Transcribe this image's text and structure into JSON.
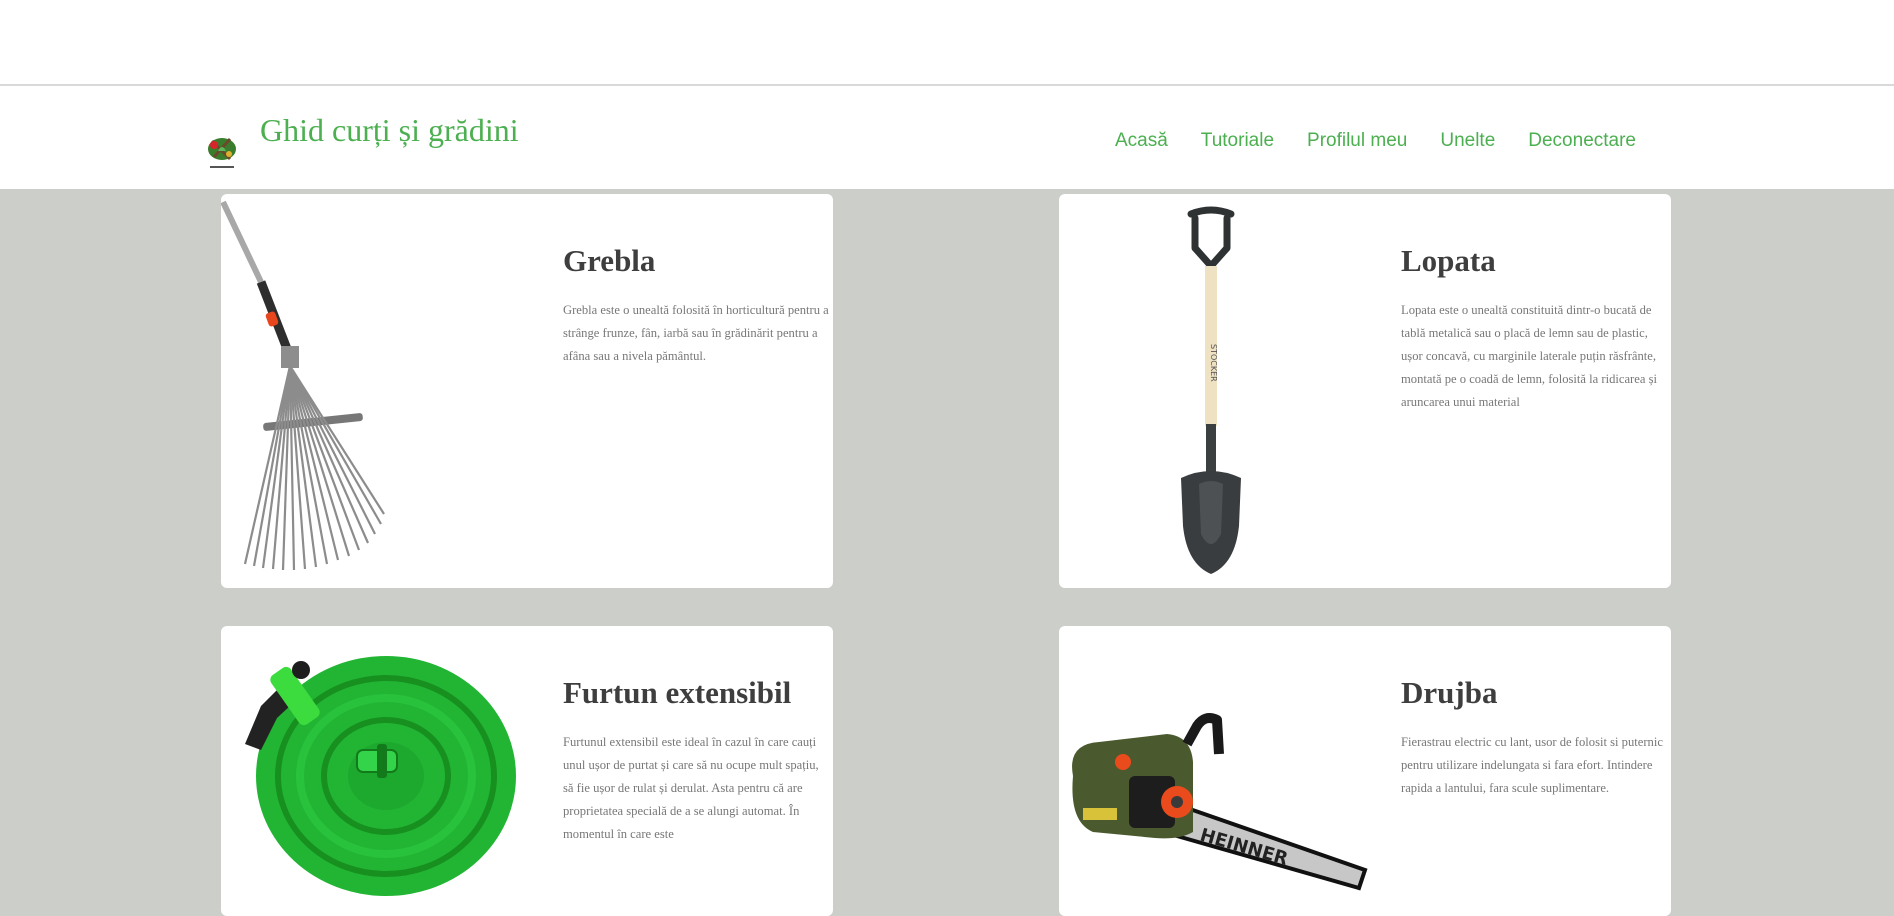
{
  "header": {
    "title": "Ghid curți și grădini",
    "logo_icon": "garden-tools-logo-icon"
  },
  "nav": {
    "items": [
      {
        "label": "Acasă"
      },
      {
        "label": "Tutoriale"
      },
      {
        "label": "Profilul meu"
      },
      {
        "label": "Unelte"
      },
      {
        "label": "Deconectare"
      }
    ]
  },
  "colors": {
    "accent": "#4caf50",
    "page_background": "#ccceca",
    "card_background": "#ffffff",
    "title_text": "#3e3e3e",
    "body_text": "#777777"
  },
  "tools": [
    {
      "name": "Grebla",
      "icon": "rake-image",
      "description": "Grebla este o unealtă folosită în horticultură pentru a strânge frunze, fân, iarbă sau în grădinărit pentru a afâna sau a nivela pământul."
    },
    {
      "name": "Lopata",
      "icon": "shovel-image",
      "description": "Lopata este o unealtă constituită dintr-o bucată de tablă metalică sau o placă de lemn sau de plastic, ușor concavă, cu marginile laterale puțin răsfrânte, montată pe o coadă de lemn, folosită la ridicarea și aruncarea unui material"
    },
    {
      "name": "Furtun extensibil",
      "icon": "garden-hose-image",
      "description": "Furtunul extensibil este ideal în cazul în care cauți unul ușor de purtat și care să nu ocupe mult spațiu, să fie ușor de rulat și derulat. Asta pentru că are proprietatea specială de a se alungi automat. În momentul în care este"
    },
    {
      "name": "Drujba",
      "icon": "chainsaw-image",
      "brand_text": "HEINNER",
      "description": "Fierastrau electric cu lant, usor de folosit si puternic pentru utilizare indelungata si fara efort. Intindere rapida a lantului, fara scule suplimentare."
    }
  ]
}
